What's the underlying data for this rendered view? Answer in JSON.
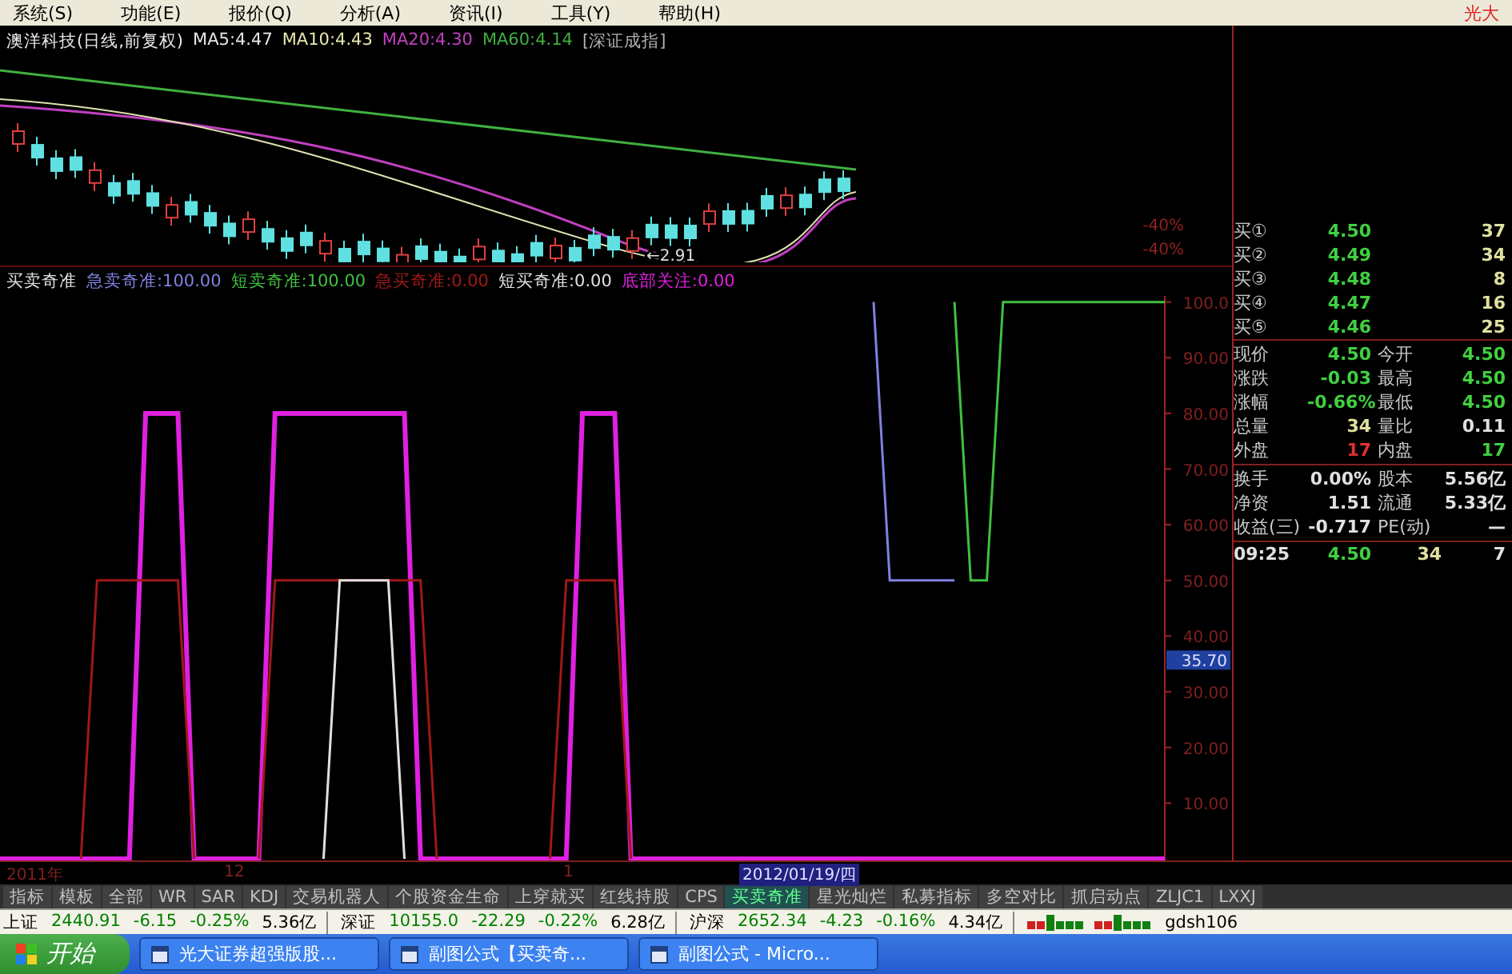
{
  "menu": {
    "items": [
      "系统(S)",
      "功能(E)",
      "报价(Q)",
      "分析(A)",
      "资讯(I)",
      "工具(Y)",
      "帮助(H)"
    ],
    "brand": "光大"
  },
  "price_chart": {
    "title": "澳洋科技(日线,前复权)",
    "ma": [
      {
        "label": "MA5:4.47",
        "color": "#e8e8e8"
      },
      {
        "label": "MA10:4.43",
        "color": "#e8e8b0"
      },
      {
        "label": "MA20:4.30",
        "color": "#c040c0"
      },
      {
        "label": "MA60:4.14",
        "color": "#40b040"
      }
    ],
    "index_ref": "[深证成指]",
    "low_marker": "←2.91",
    "axis_labels": [
      "-40%",
      "-40%"
    ]
  },
  "indicator": {
    "title": "买卖奇准",
    "legend_values": [
      ":100.00",
      ":100.00",
      ":0.00",
      ":0.00",
      ":0.00"
    ],
    "cursor_value": "35.70",
    "chart_data": {
      "type": "line",
      "categories": [
        null,
        null,
        null,
        null,
        null,
        null,
        null,
        null,
        null,
        null,
        null,
        null,
        null,
        null,
        null,
        null,
        null,
        null,
        null,
        null,
        null,
        null,
        null,
        null,
        null,
        null,
        null,
        null,
        null,
        null,
        null,
        null,
        null,
        null,
        null,
        null,
        null,
        null,
        null,
        null,
        null,
        null,
        null,
        null,
        null,
        null,
        null,
        null,
        null,
        null,
        null,
        null,
        null,
        null,
        null,
        null,
        null,
        null,
        null,
        null,
        null,
        null,
        null,
        null,
        null,
        null,
        null,
        null,
        null,
        null,
        null,
        null,
        null
      ],
      "ylim": [
        0,
        101.1
      ],
      "yticks": [
        {
          "value": 10,
          "label": "10.00"
        },
        {
          "value": 20,
          "label": "20.00"
        },
        {
          "value": 30,
          "label": "30.00"
        },
        {
          "value": 40,
          "label": "40.00"
        },
        {
          "value": 50,
          "label": "50.00"
        },
        {
          "value": 60,
          "label": "60.00"
        },
        {
          "value": 70,
          "label": "70.00"
        },
        {
          "value": 80,
          "label": "80.00"
        },
        {
          "value": 90,
          "label": "90.00"
        },
        {
          "value": 100,
          "label": "100.0"
        }
      ],
      "series": [
        {
          "name": "急卖奇准",
          "color": "#8080e0",
          "values": [
            null,
            null,
            null,
            null,
            null,
            null,
            null,
            null,
            null,
            null,
            null,
            null,
            null,
            null,
            null,
            null,
            null,
            null,
            null,
            null,
            null,
            null,
            null,
            null,
            null,
            null,
            null,
            null,
            null,
            null,
            null,
            null,
            null,
            null,
            null,
            null,
            null,
            null,
            null,
            null,
            null,
            null,
            null,
            null,
            null,
            null,
            null,
            null,
            null,
            null,
            null,
            null,
            null,
            null,
            100,
            50,
            50,
            50,
            50,
            50,
            null,
            null,
            null,
            null,
            null,
            null,
            null,
            null,
            null,
            null,
            null,
            null,
            null
          ]
        },
        {
          "name": "短卖奇准",
          "color": "#40c040",
          "values": [
            null,
            null,
            null,
            null,
            null,
            null,
            null,
            null,
            null,
            null,
            null,
            null,
            null,
            null,
            null,
            null,
            null,
            null,
            null,
            null,
            null,
            null,
            null,
            null,
            null,
            null,
            null,
            null,
            null,
            null,
            null,
            null,
            null,
            null,
            null,
            null,
            null,
            null,
            null,
            null,
            null,
            null,
            null,
            null,
            null,
            null,
            null,
            null,
            null,
            null,
            null,
            null,
            null,
            null,
            null,
            null,
            null,
            null,
            null,
            100,
            50,
            50,
            100,
            100,
            100,
            100,
            100,
            100,
            100,
            100,
            100,
            100,
            100
          ]
        },
        {
          "name": "急买奇准",
          "color": "#a01818",
          "values": [
            null,
            null,
            null,
            null,
            null,
            0,
            50,
            50,
            50,
            50,
            50,
            50,
            0,
            null,
            null,
            null,
            0,
            50,
            50,
            50,
            50,
            50,
            50,
            50,
            50,
            50,
            50,
            0,
            null,
            null,
            null,
            null,
            null,
            null,
            0,
            50,
            50,
            50,
            50,
            0,
            null,
            null,
            null,
            null,
            null,
            null,
            null,
            null,
            null,
            null,
            null,
            null,
            null,
            null,
            null,
            null,
            null,
            null,
            null,
            null,
            null,
            null,
            null,
            null,
            null,
            null,
            null,
            null,
            null,
            null,
            null,
            null,
            null
          ]
        },
        {
          "name": "短买奇准",
          "color": "#e0e0e0",
          "values": [
            null,
            null,
            null,
            null,
            null,
            null,
            null,
            null,
            null,
            null,
            null,
            null,
            null,
            null,
            null,
            null,
            null,
            null,
            null,
            null,
            0,
            50,
            50,
            50,
            50,
            0,
            null,
            null,
            null,
            null,
            null,
            null,
            null,
            null,
            null,
            null,
            null,
            null,
            null,
            null,
            null,
            null,
            null,
            null,
            null,
            null,
            null,
            null,
            null,
            null,
            null,
            null,
            null,
            null,
            null,
            null,
            null,
            null,
            null,
            null,
            null,
            null,
            null,
            null,
            null,
            null,
            null,
            null,
            null,
            null,
            null,
            null,
            null
          ]
        },
        {
          "name": "底部关注",
          "color": "#e020e0",
          "values": [
            0,
            0,
            0,
            0,
            0,
            0,
            0,
            0,
            0,
            80,
            80,
            80,
            0,
            0,
            0,
            0,
            0,
            80,
            80,
            80,
            80,
            80,
            80,
            80,
            80,
            80,
            0,
            0,
            0,
            0,
            0,
            0,
            0,
            0,
            0,
            0,
            80,
            80,
            80,
            0,
            0,
            0,
            0,
            0,
            0,
            0,
            0,
            0,
            0,
            0,
            0,
            0,
            0,
            0,
            0,
            0,
            0,
            0,
            0,
            0,
            0,
            0,
            0,
            0,
            0,
            0,
            0,
            0,
            0,
            0,
            0,
            0,
            0
          ]
        }
      ]
    }
  },
  "x_axis": {
    "labels": [
      "2011年",
      "12",
      "1"
    ],
    "cursor_date": "2012/01/19/四"
  },
  "order_book": [
    {
      "label": "买①",
      "price": "4.50",
      "volume": "37"
    },
    {
      "label": "买②",
      "price": "4.49",
      "volume": "34"
    },
    {
      "label": "买③",
      "price": "4.48",
      "volume": "8"
    },
    {
      "label": "买④",
      "price": "4.47",
      "volume": "16"
    },
    {
      "label": "买⑤",
      "price": "4.46",
      "volume": "25"
    }
  ],
  "quote_sections": [
    {
      "cells": [
        {
          "label": "现价",
          "value": "4.50",
          "color": "#40d040"
        },
        {
          "label": "今开",
          "value": "4.50",
          "color": "#40d040"
        },
        {
          "label": "涨跌",
          "value": "-0.03",
          "color": "#40d040"
        },
        {
          "label": "最高",
          "value": "4.50",
          "color": "#40d040"
        },
        {
          "label": "涨幅",
          "value": "-0.66%",
          "color": "#40d040"
        },
        {
          "label": "最低",
          "value": "4.50",
          "color": "#40d040"
        },
        {
          "label": "总量",
          "value": "34",
          "color": "#e0e0a0"
        },
        {
          "label": "量比",
          "value": "0.11",
          "color": "#e0e0e0"
        },
        {
          "label": "外盘",
          "value": "17",
          "color": "#e03030"
        },
        {
          "label": "内盘",
          "value": "17",
          "color": "#40d040"
        }
      ]
    },
    {
      "cells": [
        {
          "label": "换手",
          "value": "0.00%",
          "color": "#e0e0e0"
        },
        {
          "label": "股本",
          "value": "5.56亿",
          "color": "#e0e0e0"
        },
        {
          "label": "净资",
          "value": "1.51",
          "color": "#e0e0e0"
        },
        {
          "label": "流通",
          "value": "5.33亿",
          "color": "#e0e0e0"
        },
        {
          "label": "收益(三)",
          "value": "-0.717",
          "color": "#e0e0e0"
        },
        {
          "label": "PE(动)",
          "value": "—",
          "color": "#e0e0e0"
        }
      ]
    }
  ],
  "ticks": [
    {
      "time": "09:25",
      "price": "4.50",
      "volume": "34",
      "count": "7"
    }
  ],
  "tabs": [
    {
      "label": "指标",
      "selected": false
    },
    {
      "label": "模板",
      "selected": false
    },
    {
      "label": "全部",
      "selected": false
    },
    {
      "label": "WR",
      "selected": false
    },
    {
      "label": "SAR",
      "selected": false
    },
    {
      "label": "KDJ",
      "selected": false
    },
    {
      "label": "交易机器人",
      "selected": false
    },
    {
      "label": "个股资金生命",
      "selected": false
    },
    {
      "label": "上穿就买",
      "selected": false
    },
    {
      "label": "红线持股",
      "selected": false
    },
    {
      "label": "CPS",
      "selected": false
    },
    {
      "label": "买卖奇准",
      "selected": true
    },
    {
      "label": "星光灿烂",
      "selected": false
    },
    {
      "label": "私募指标",
      "selected": false
    },
    {
      "label": "多空对比",
      "selected": false
    },
    {
      "label": "抓启动点",
      "selected": false
    },
    {
      "label": "ZLJC1",
      "selected": false
    },
    {
      "label": "LXXJ",
      "selected": false
    }
  ],
  "status_bar": {
    "indices": [
      {
        "name": "上证",
        "value": "2440.91",
        "change": "-6.15",
        "percent": "-0.25%",
        "amount": "5.36亿"
      },
      {
        "name": "深证",
        "value": "10155.0",
        "change": "-22.29",
        "percent": "-0.22%",
        "amount": "6.28亿"
      },
      {
        "name": "沪深",
        "value": "2652.34",
        "change": "-4.23",
        "percent": "-0.16%",
        "amount": "4.34亿"
      }
    ],
    "server": "gdsh106"
  },
  "taskbar": {
    "start": "开始",
    "tasks": [
      "光大证券超强版股...",
      "副图公式【买卖奇...",
      "副图公式 - Micro..."
    ]
  }
}
